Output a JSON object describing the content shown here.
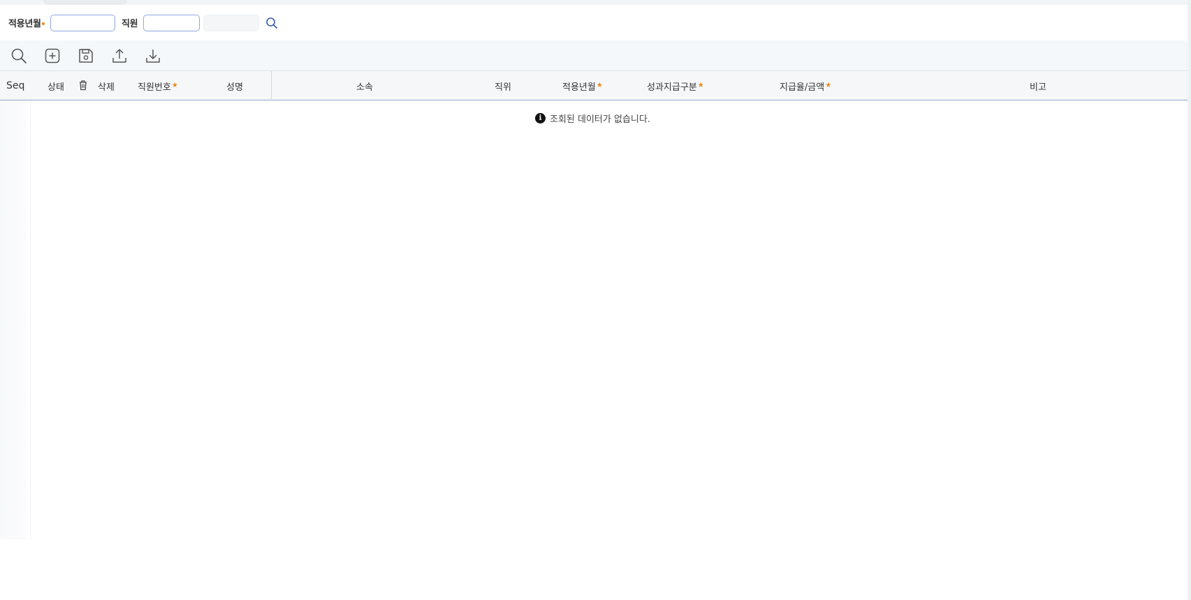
{
  "search": {
    "apply_month_label": "적용년월",
    "apply_month_value": "",
    "employee_label": "직원",
    "employee_value": "",
    "employee_name_value": ""
  },
  "toolbar": {
    "icons": [
      "search-icon",
      "add-row-icon",
      "save-icon",
      "upload-icon",
      "download-icon"
    ]
  },
  "grid": {
    "columns": {
      "seq": "Seq",
      "status": "상태",
      "delete": "삭제",
      "employee_no": "직원번호",
      "name": "성명",
      "department": "소속",
      "position": "직위",
      "apply_month": "적용년월",
      "bonus_type": "성과지급구분",
      "rate_amount": "지급율/금액",
      "remarks": "비고"
    },
    "required_marker": "★",
    "empty_message": "조회된 데이터가 없습니다."
  },
  "colors": {
    "accent_blue": "#3b5bb5",
    "required_orange": "#e8891a",
    "header_border": "#8fa9c9"
  }
}
